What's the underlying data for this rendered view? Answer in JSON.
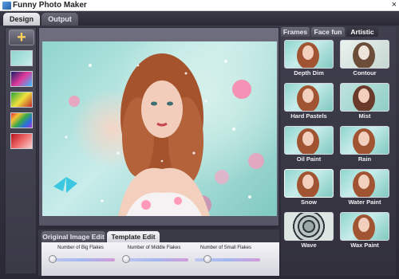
{
  "window": {
    "title": "Funny Photo Maker",
    "close_glyph": "×"
  },
  "main_tabs": {
    "design": "Design",
    "output": "Output"
  },
  "left_strip": {
    "add_glyph": "+"
  },
  "lower_tabs": {
    "original": "Original Image Edit",
    "template": "Template Edit"
  },
  "sliders": [
    {
      "label": "Number of Big Flakes",
      "value": 0.05
    },
    {
      "label": "Number of Middle Flakes",
      "value": 0.05
    },
    {
      "label": "Number of Small Flakes",
      "value": 0.2
    }
  ],
  "right_tabs": {
    "frames": "Frames",
    "face_fun": "Face fun",
    "artistic": "Artistic"
  },
  "effects": [
    {
      "name": "Depth Dim"
    },
    {
      "name": "Contour"
    },
    {
      "name": "Hard Pastels"
    },
    {
      "name": "Mist"
    },
    {
      "name": "Oil Paint"
    },
    {
      "name": "Rain"
    },
    {
      "name": "Snow"
    },
    {
      "name": "Water Paint"
    },
    {
      "name": "Wave"
    },
    {
      "name": "Wax Paint"
    }
  ],
  "colors": {
    "accent": "#ffd25a",
    "panel": "#3a3946",
    "stage": "#6f6e7e"
  }
}
